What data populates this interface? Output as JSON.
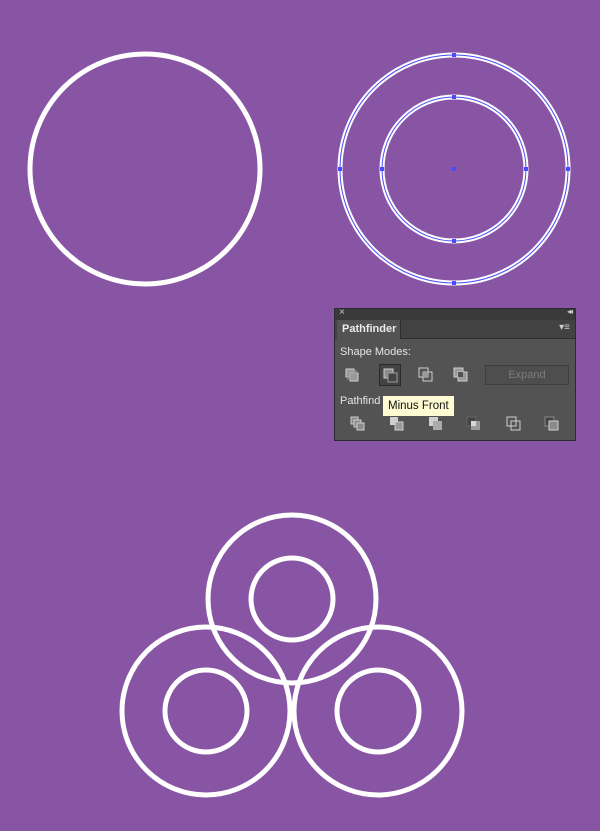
{
  "canvas": {
    "background_color": "#8855a4",
    "stroke_color": "#ffffff",
    "selection_color": "#4a4aff"
  },
  "panel": {
    "title": "Pathfinder",
    "shape_modes_label": "Shape Modes:",
    "pathfinders_label": "Pathfind",
    "expand_label": "Expand",
    "tooltip": "Minus Front",
    "close_glyph": "×",
    "collapse_glyph": "◂◂",
    "menu_glyph": "▾≡",
    "shape_modes": [
      {
        "name": "unite",
        "active": false
      },
      {
        "name": "minus-front",
        "active": true
      },
      {
        "name": "intersect",
        "active": false
      },
      {
        "name": "exclude",
        "active": false
      }
    ],
    "pathfinders": [
      {
        "name": "divide"
      },
      {
        "name": "trim"
      },
      {
        "name": "merge"
      },
      {
        "name": "crop"
      },
      {
        "name": "outline"
      },
      {
        "name": "minus-back"
      }
    ]
  }
}
